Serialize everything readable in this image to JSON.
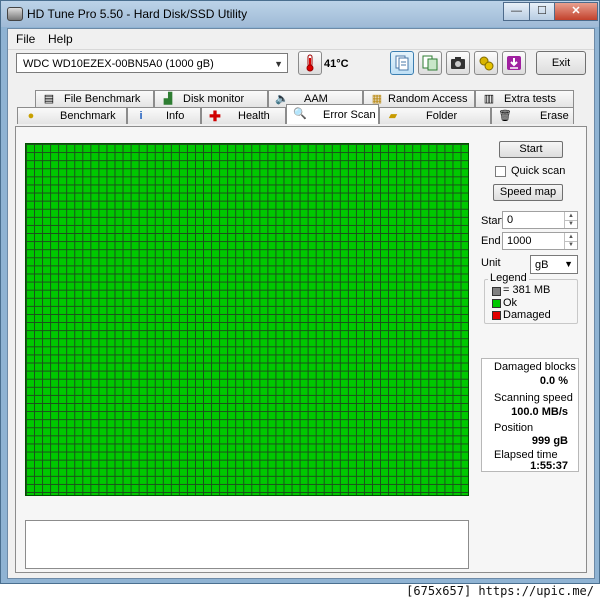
{
  "window": {
    "title": "HD Tune Pro 5.50 - Hard Disk/SSD Utility",
    "minimize_glyph": "—",
    "maximize_glyph": "☐",
    "close_glyph": "✕"
  },
  "menu": {
    "file_label": "File",
    "help_label": "Help"
  },
  "toolbar": {
    "drive": "WDC WD10EZEX-00BN5A0 (1000 gB)",
    "temperature": "41°C",
    "exit_label": "Exit",
    "icons": [
      "thermometer-icon",
      "copy-text-icon",
      "copy-screenshot-icon",
      "camera-icon",
      "settings-icon",
      "save-icon"
    ]
  },
  "tabs": {
    "row1": [
      "File Benchmark",
      "Disk monitor",
      "AAM",
      "Random Access",
      "Extra tests"
    ],
    "row2": [
      "Benchmark",
      "Info",
      "Health",
      "Error Scan",
      "Folder Usage",
      "Erase"
    ],
    "active": "Error Scan"
  },
  "controls": {
    "start_button": "Start",
    "quick_scan_label": "Quick scan",
    "quick_scan_checked": false,
    "speed_map_button": "Speed map",
    "start_label": "Start",
    "start_value": "0",
    "end_label": "End",
    "end_value": "1000",
    "unit_label": "Unit",
    "unit_value": "gB"
  },
  "legend": {
    "title": "Legend",
    "items": [
      {
        "label": "= 381 MB",
        "color": "#808080"
      },
      {
        "label": "Ok",
        "color": "#00c800"
      },
      {
        "label": "Damaged",
        "color": "#e00000"
      }
    ]
  },
  "stats": {
    "damaged_blocks_label": "Damaged blocks",
    "damaged_blocks_value": "0.0 %",
    "scanning_speed_label": "Scanning speed",
    "scanning_speed_value": "100.0 MB/s",
    "position_label": "Position",
    "position_value": "999 gB",
    "elapsed_label": "Elapsed time",
    "elapsed_value": "1:55:37"
  },
  "scan_grid": {
    "status": "all blocks ok",
    "ok_color": "#00c800"
  },
  "footer": {
    "text": "[675x657] https://upic.me/"
  }
}
